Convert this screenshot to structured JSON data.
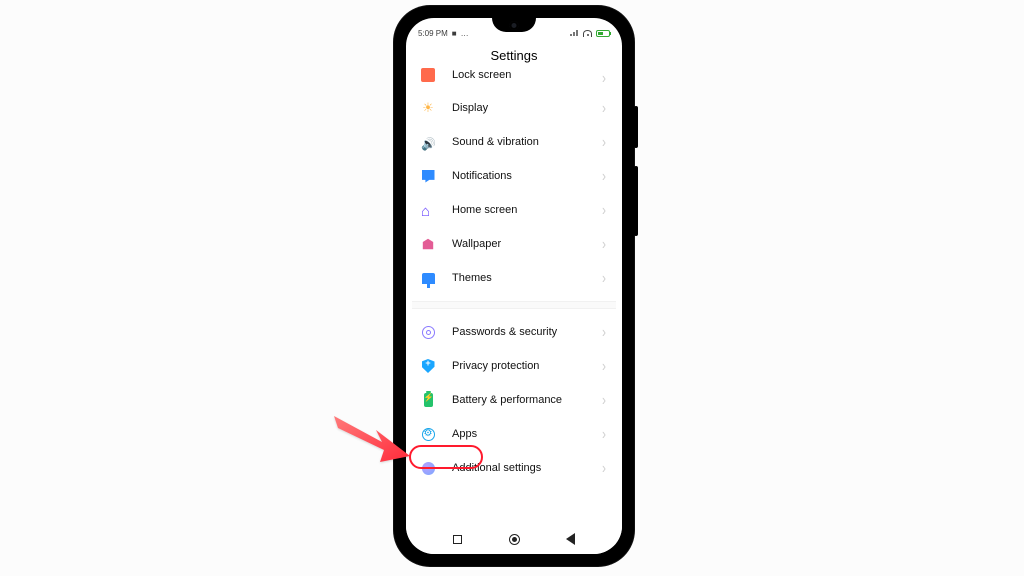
{
  "statusbar": {
    "time": "5:09 PM",
    "rec_icon": "rec",
    "icons": "◎ ⊘"
  },
  "title": "Settings",
  "group1": [
    {
      "id": "lock-screen",
      "label": "Lock screen",
      "icon": "ico-lock",
      "partial": true
    },
    {
      "id": "display",
      "label": "Display",
      "icon": "ico-disp"
    },
    {
      "id": "sound-vibration",
      "label": "Sound & vibration",
      "icon": "ico-sound"
    },
    {
      "id": "notifications",
      "label": "Notifications",
      "icon": "ico-notif"
    },
    {
      "id": "home-screen",
      "label": "Home screen",
      "icon": "ico-home"
    },
    {
      "id": "wallpaper",
      "label": "Wallpaper",
      "icon": "ico-wall"
    },
    {
      "id": "themes",
      "label": "Themes",
      "icon": "ico-theme"
    }
  ],
  "group2": [
    {
      "id": "passwords-security",
      "label": "Passwords & security",
      "icon": "ico-pwd"
    },
    {
      "id": "privacy-protection",
      "label": "Privacy protection",
      "icon": "ico-priv"
    },
    {
      "id": "battery-performance",
      "label": "Battery & performance",
      "icon": "ico-batt"
    },
    {
      "id": "apps",
      "label": "Apps",
      "icon": "ico-apps",
      "highlighted": true
    },
    {
      "id": "additional-settings",
      "label": "Additional settings",
      "icon": "ico-add"
    }
  ],
  "callout": {
    "target": "apps",
    "color": "#ff1a2d"
  }
}
